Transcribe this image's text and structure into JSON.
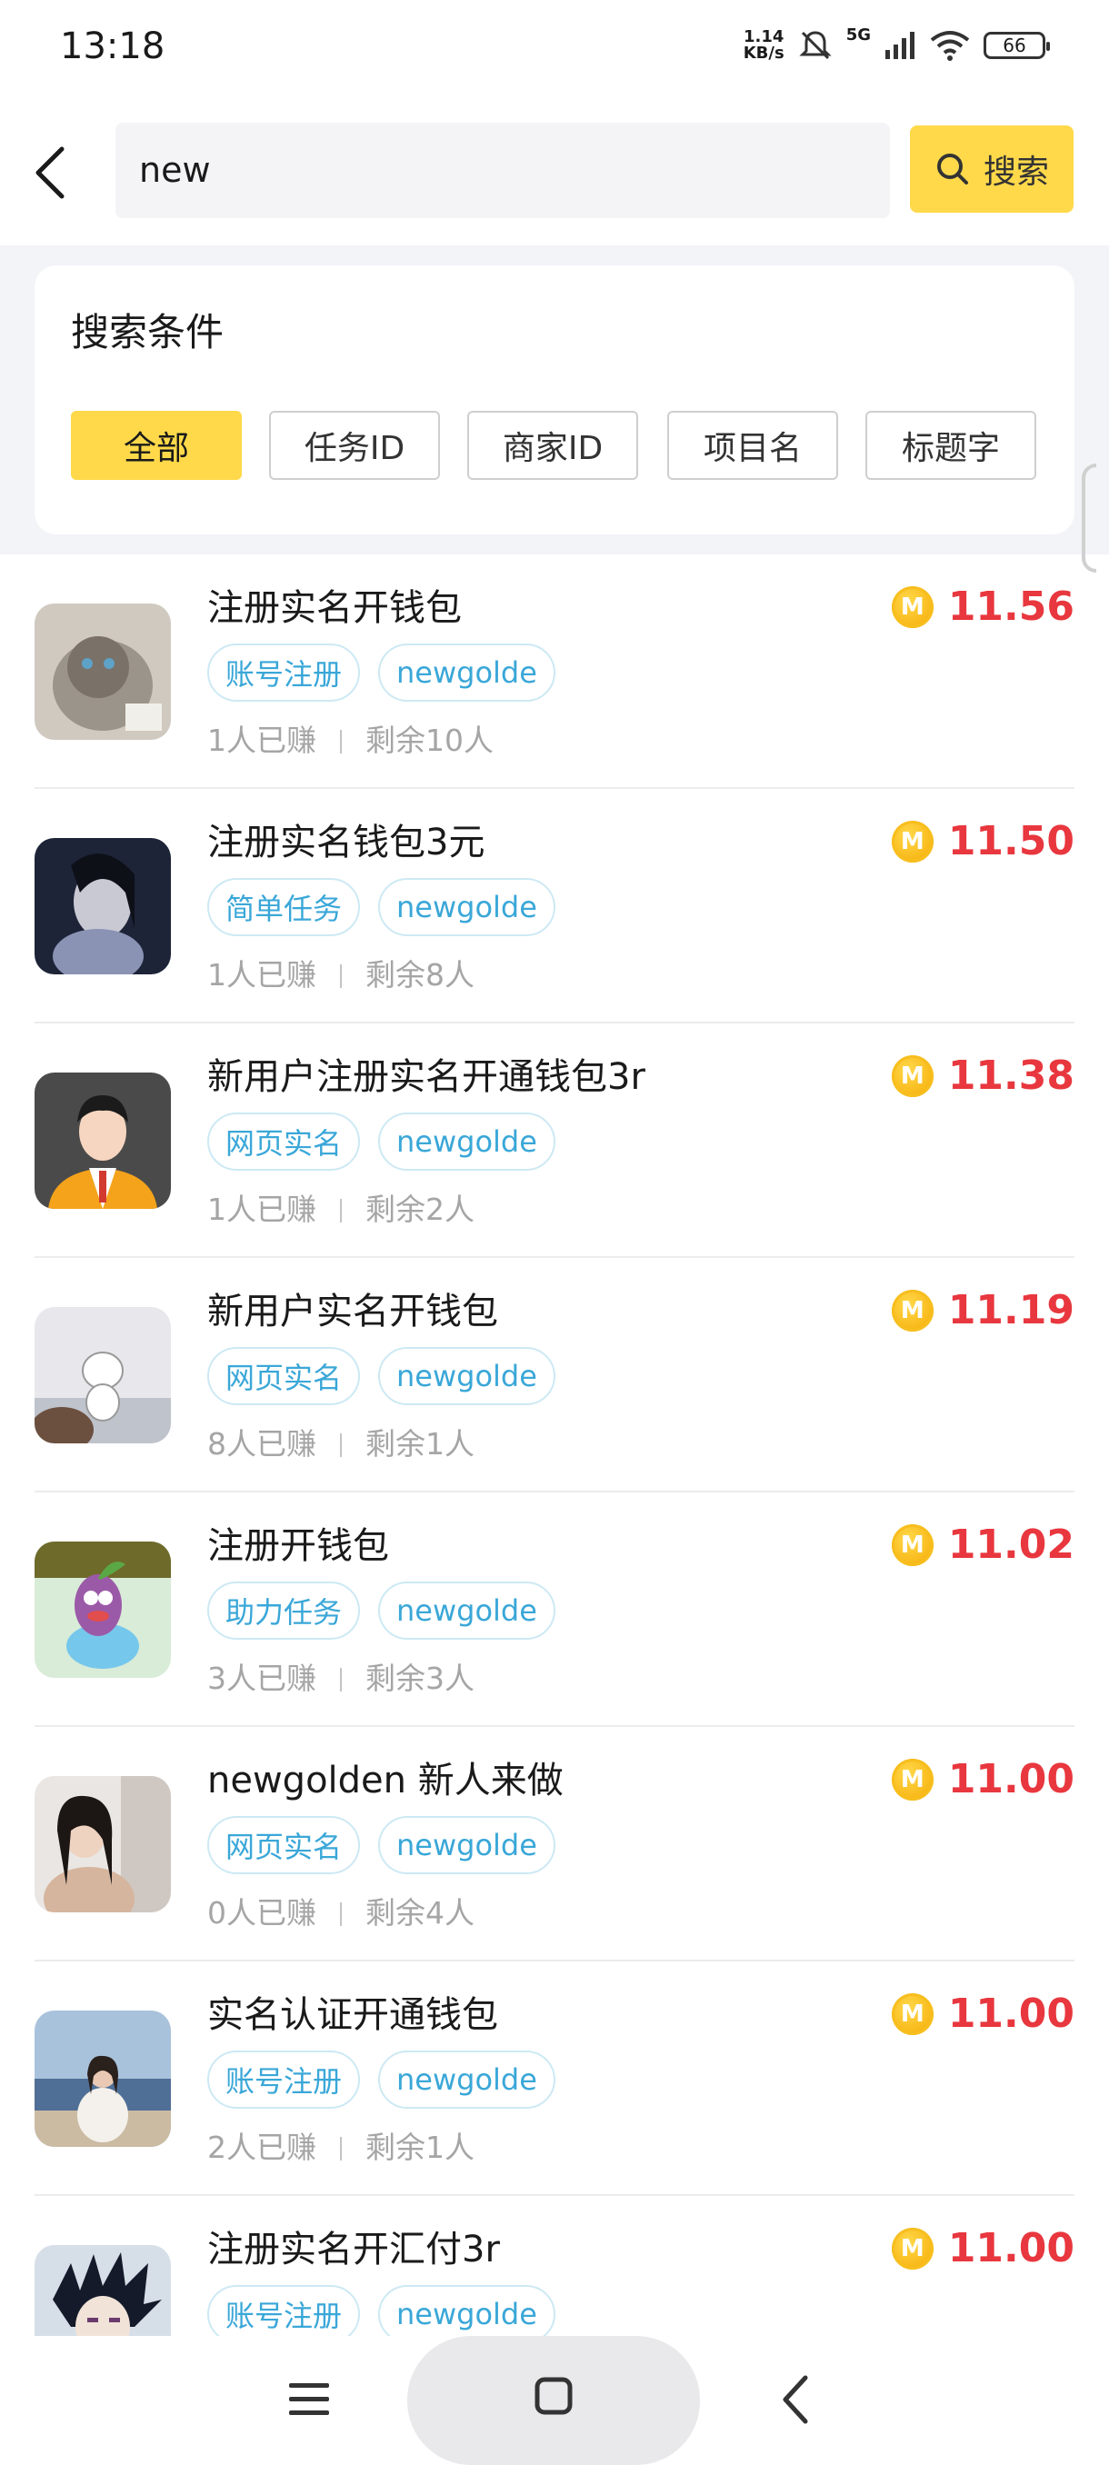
{
  "status": {
    "time": "13:18",
    "net_speed_top": "1.14",
    "net_speed_bottom": "KB/s",
    "network": "5G",
    "battery": "66"
  },
  "search": {
    "query": "new",
    "button_label": "搜索"
  },
  "filter": {
    "title": "搜索条件",
    "chips": [
      "全部",
      "任务ID",
      "商家ID",
      "项目名",
      "标题字"
    ],
    "selected": "全部"
  },
  "tasks": [
    {
      "title": "注册实名开钱包",
      "category": "账号注册",
      "merchant": "newgolde",
      "earned": "1人已赚",
      "remaining": "剩余10人",
      "price": "11.56"
    },
    {
      "title": "注册实名钱包3元",
      "category": "简单任务",
      "merchant": "newgolde",
      "earned": "1人已赚",
      "remaining": "剩余8人",
      "price": "11.50"
    },
    {
      "title": "新用户注册实名开通钱包3r",
      "category": "网页实名",
      "merchant": "newgolde",
      "earned": "1人已赚",
      "remaining": "剩余2人",
      "price": "11.38"
    },
    {
      "title": "新用户实名开钱包",
      "category": "网页实名",
      "merchant": "newgolde",
      "earned": "8人已赚",
      "remaining": "剩余1人",
      "price": "11.19"
    },
    {
      "title": "注册开钱包",
      "category": "助力任务",
      "merchant": "newgolde",
      "earned": "3人已赚",
      "remaining": "剩余3人",
      "price": "11.02"
    },
    {
      "title": "newgolden 新人来做",
      "category": "网页实名",
      "merchant": "newgolde",
      "earned": "0人已赚",
      "remaining": "剩余4人",
      "price": "11.00"
    },
    {
      "title": "实名认证开通钱包",
      "category": "账号注册",
      "merchant": "newgolde",
      "earned": "2人已赚",
      "remaining": "剩余1人",
      "price": "11.00"
    },
    {
      "title": "注册实名开汇付3r",
      "category": "账号注册",
      "merchant": "newgolde",
      "earned": "",
      "remaining": "",
      "price": "11.00"
    }
  ],
  "coin_symbol": "M",
  "colors": {
    "accent_yellow": "#ffd94a",
    "price_red": "#e8373e",
    "tag_blue": "#3aa7d8",
    "background_gray": "#f3f4f8"
  }
}
